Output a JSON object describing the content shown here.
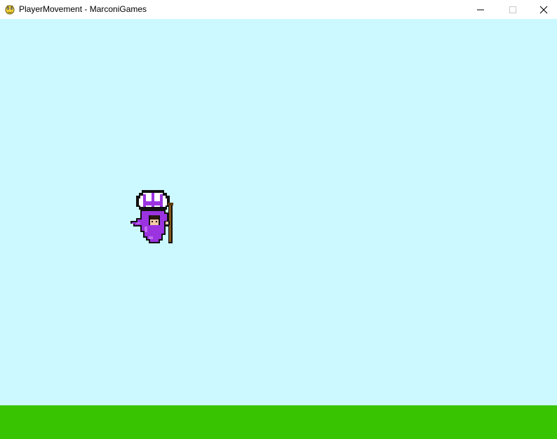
{
  "window": {
    "title": "PlayerMovement - MarconiGames",
    "app_icon": "pygame-snake-icon",
    "controls": {
      "minimize_icon": "minimize-icon",
      "maximize_icon": "maximize-icon",
      "close_icon": "close-icon"
    }
  },
  "game": {
    "sky_color": "#ccf8ff",
    "ground_color": "#38c400",
    "player": {
      "sprite": "wizard-with-staff",
      "hat_color": "#9b33e0",
      "robe_color": "#9b33e0",
      "staff_color": "#8a5a1a"
    }
  }
}
